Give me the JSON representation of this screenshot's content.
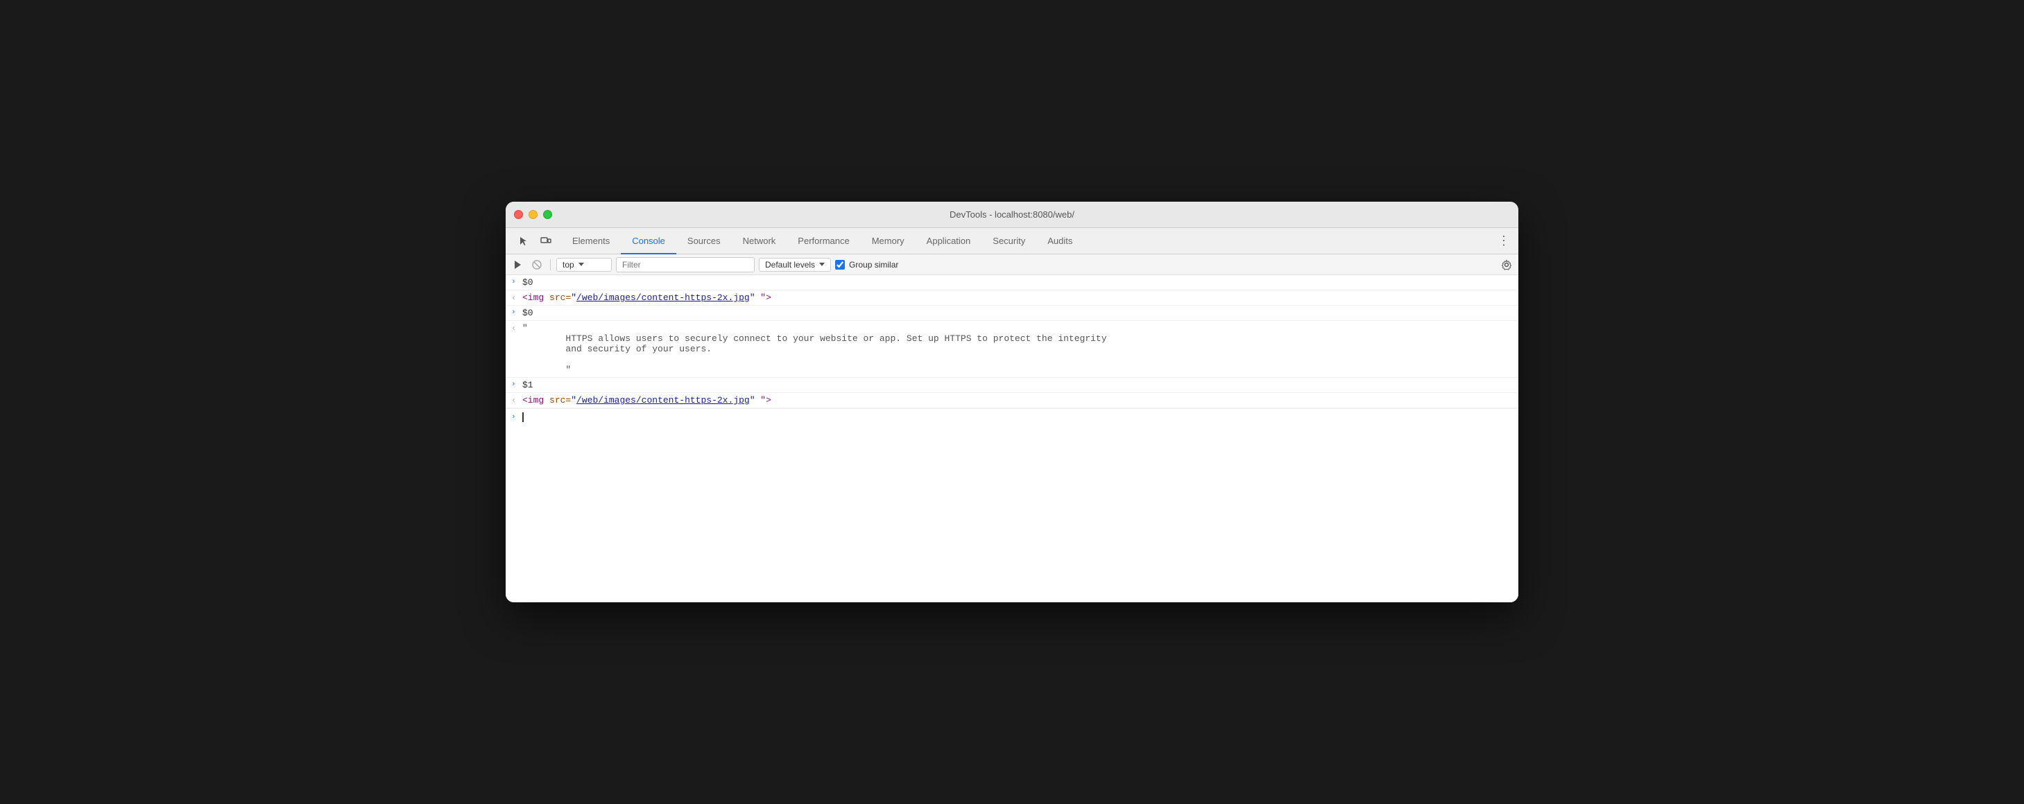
{
  "window": {
    "title": "DevTools - localhost:8080/web/"
  },
  "tabs": {
    "items": [
      {
        "id": "elements",
        "label": "Elements",
        "active": false
      },
      {
        "id": "console",
        "label": "Console",
        "active": true
      },
      {
        "id": "sources",
        "label": "Sources",
        "active": false
      },
      {
        "id": "network",
        "label": "Network",
        "active": false
      },
      {
        "id": "performance",
        "label": "Performance",
        "active": false
      },
      {
        "id": "memory",
        "label": "Memory",
        "active": false
      },
      {
        "id": "application",
        "label": "Application",
        "active": false
      },
      {
        "id": "security",
        "label": "Security",
        "active": false
      },
      {
        "id": "audits",
        "label": "Audits",
        "active": false
      }
    ]
  },
  "toolbar": {
    "context_value": "top",
    "filter_placeholder": "Filter",
    "levels_label": "Default levels",
    "group_similar_label": "Group similar"
  },
  "console": {
    "entries": [
      {
        "type": "input",
        "arrow": ">",
        "content": "$0"
      },
      {
        "type": "response",
        "arrow": "<",
        "tag_open": "<img src=",
        "attr_value": "/web/images/content-https-2x.jpg",
        "tag_close": "\" \">"
      },
      {
        "type": "input",
        "arrow": ">",
        "content": "$0"
      },
      {
        "type": "response_text",
        "arrow": "<",
        "quote": "\"",
        "text_line1": "        HTTPS allows users to securely connect to your website or app. Set up HTTPS to protect the integrity",
        "text_line2": "        and security of your users.",
        "text_line3": "",
        "text_line4": "        \""
      },
      {
        "type": "input",
        "arrow": ">",
        "content": "$1"
      },
      {
        "type": "response",
        "arrow": "<",
        "tag_open": "<img src=",
        "attr_value": "/web/images/content-https-2x.jpg",
        "tag_close": "\" \">"
      }
    ],
    "input_arrow": ">",
    "cursor_char": "|"
  }
}
